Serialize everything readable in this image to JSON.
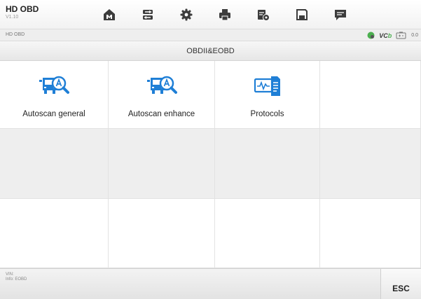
{
  "app": {
    "title": "HD OBD",
    "version": "V1.10"
  },
  "toolbar": {
    "items": [
      {
        "name": "home-button",
        "icon": "home-icon"
      },
      {
        "name": "vehicle-swap-button",
        "icon": "car-swap-icon"
      },
      {
        "name": "settings-button",
        "icon": "gear-icon"
      },
      {
        "name": "print-button",
        "icon": "printer-icon"
      },
      {
        "name": "report-button",
        "icon": "report-icon"
      },
      {
        "name": "save-button",
        "icon": "save-icon"
      },
      {
        "name": "message-button",
        "icon": "chat-icon"
      }
    ]
  },
  "statusbar": {
    "breadcrumb": "HD OBD",
    "vci_label_prefix": "VC",
    "vci_label_suffix": "b",
    "battery_value": "0.0",
    "connection_icon": "connection-status-icon",
    "battery_icon": "battery-icon"
  },
  "section": {
    "title": "OBDII&EOBD"
  },
  "tiles": [
    {
      "label": "Autoscan general",
      "icon": "bus-search-icon"
    },
    {
      "label": "Autoscan enhance",
      "icon": "bus-search-icon"
    },
    {
      "label": "Protocols",
      "icon": "protocol-document-icon"
    }
  ],
  "footer": {
    "vin_label": "VIN:",
    "info_label": "Info: EOBD",
    "esc_label": "ESC"
  },
  "colors": {
    "accent_blue": "#1f7fd6",
    "status_green": "#4caf50",
    "icon_gray": "#3c3c3c"
  }
}
